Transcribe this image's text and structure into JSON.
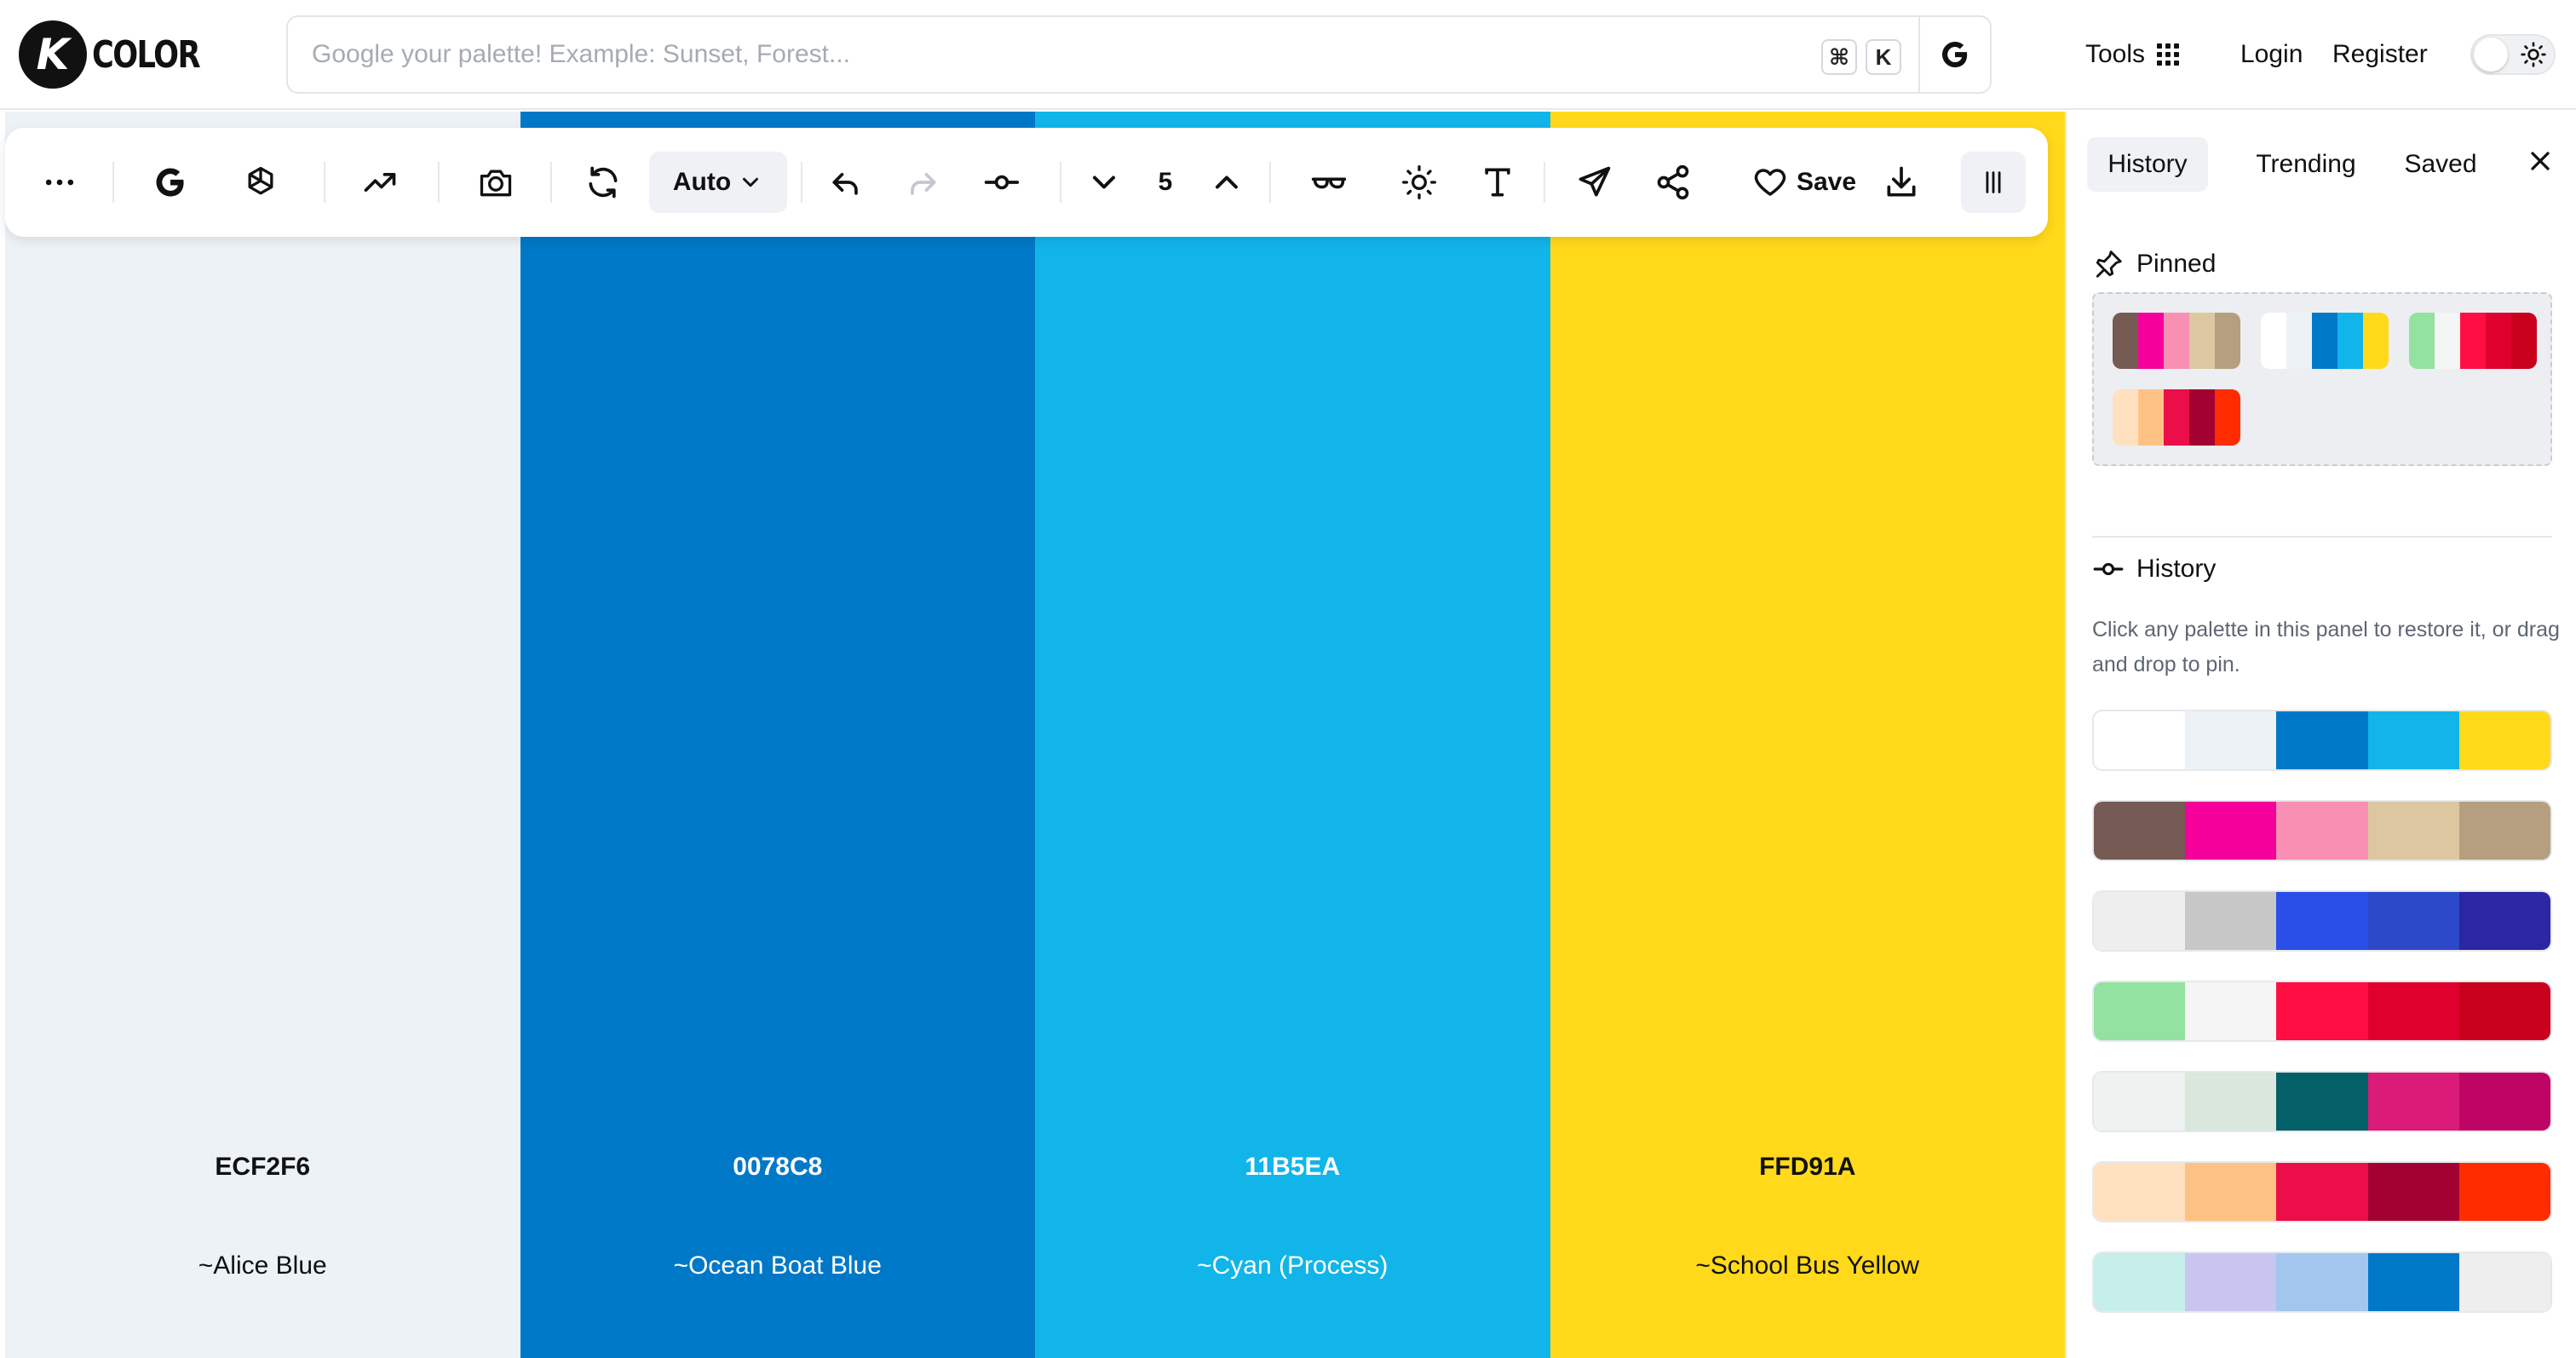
{
  "header": {
    "logo_mark": "K",
    "logo_text": "COLOR",
    "search_placeholder": "Google your palette! Example: Sunset, Forest...",
    "kbd_cmd": "⌘",
    "kbd_k": "K",
    "nav_tools": "Tools",
    "nav_login": "Login",
    "nav_register": "Register"
  },
  "toolbar": {
    "mode_label": "Auto",
    "count": "5",
    "save_label": "Save"
  },
  "palette": {
    "swatches": [
      {
        "hex": "ECF2F6",
        "name": "~Alice Blue",
        "color": "#ECF2F6",
        "text_color": "#111111"
      },
      {
        "hex": "0078C8",
        "name": "~Ocean Boat Blue",
        "color": "#0078C8",
        "text_color": "#FFFFFF"
      },
      {
        "hex": "11B5EA",
        "name": "~Cyan (Process)",
        "color": "#11B5EA",
        "text_color": "#FFFFFF"
      },
      {
        "hex": "FFD91A",
        "name": "~School Bus Yellow",
        "color": "#FFD91A",
        "text_color": "#111111"
      }
    ]
  },
  "sidebar": {
    "tabs": {
      "history": "History",
      "trending": "Trending",
      "saved": "Saved"
    },
    "pinned_title": "Pinned",
    "history_title": "History",
    "history_desc": "Click any palette in this panel to restore it, or drag and drop to pin.",
    "pinned": [
      [
        "#765A54",
        "#F5009A",
        "#F98FB3",
        "#DDC7A0",
        "#B59F7F"
      ],
      [
        "#FFFFFF",
        "#ECF2F6",
        "#0078C8",
        "#11B5EA",
        "#FFD91A"
      ],
      [
        "#93E29F",
        "#F5F5F5",
        "#FF0E44",
        "#DF002E",
        "#C8001C"
      ],
      [
        "#FFE1C0",
        "#FFC285",
        "#EC0E48",
        "#A30132",
        "#FF2C00"
      ]
    ],
    "history": [
      [
        "#FFFFFF",
        "#ECF2F6",
        "#0078C8",
        "#11B5EA",
        "#FFD91A"
      ],
      [
        "#765A54",
        "#F5009A",
        "#F98FB3",
        "#DDC7A0",
        "#B59F7F"
      ],
      [
        "#EEEEEE",
        "#C7C7C7",
        "#2A4FE8",
        "#2C49C9",
        "#2B26A2"
      ],
      [
        "#93E29F",
        "#F5F5F5",
        "#FF0E44",
        "#DF002E",
        "#C8001C"
      ],
      [
        "#EEF2F0",
        "#D9E7DD",
        "#036068",
        "#DA1B77",
        "#BE0563"
      ],
      [
        "#FFE1C0",
        "#FFC285",
        "#EC0E48",
        "#A30132",
        "#FF2C00"
      ],
      [
        "#C6EEEB",
        "#C8C6F1",
        "#A2C6EE",
        "#0078C8",
        "#EEEEEE"
      ]
    ]
  }
}
